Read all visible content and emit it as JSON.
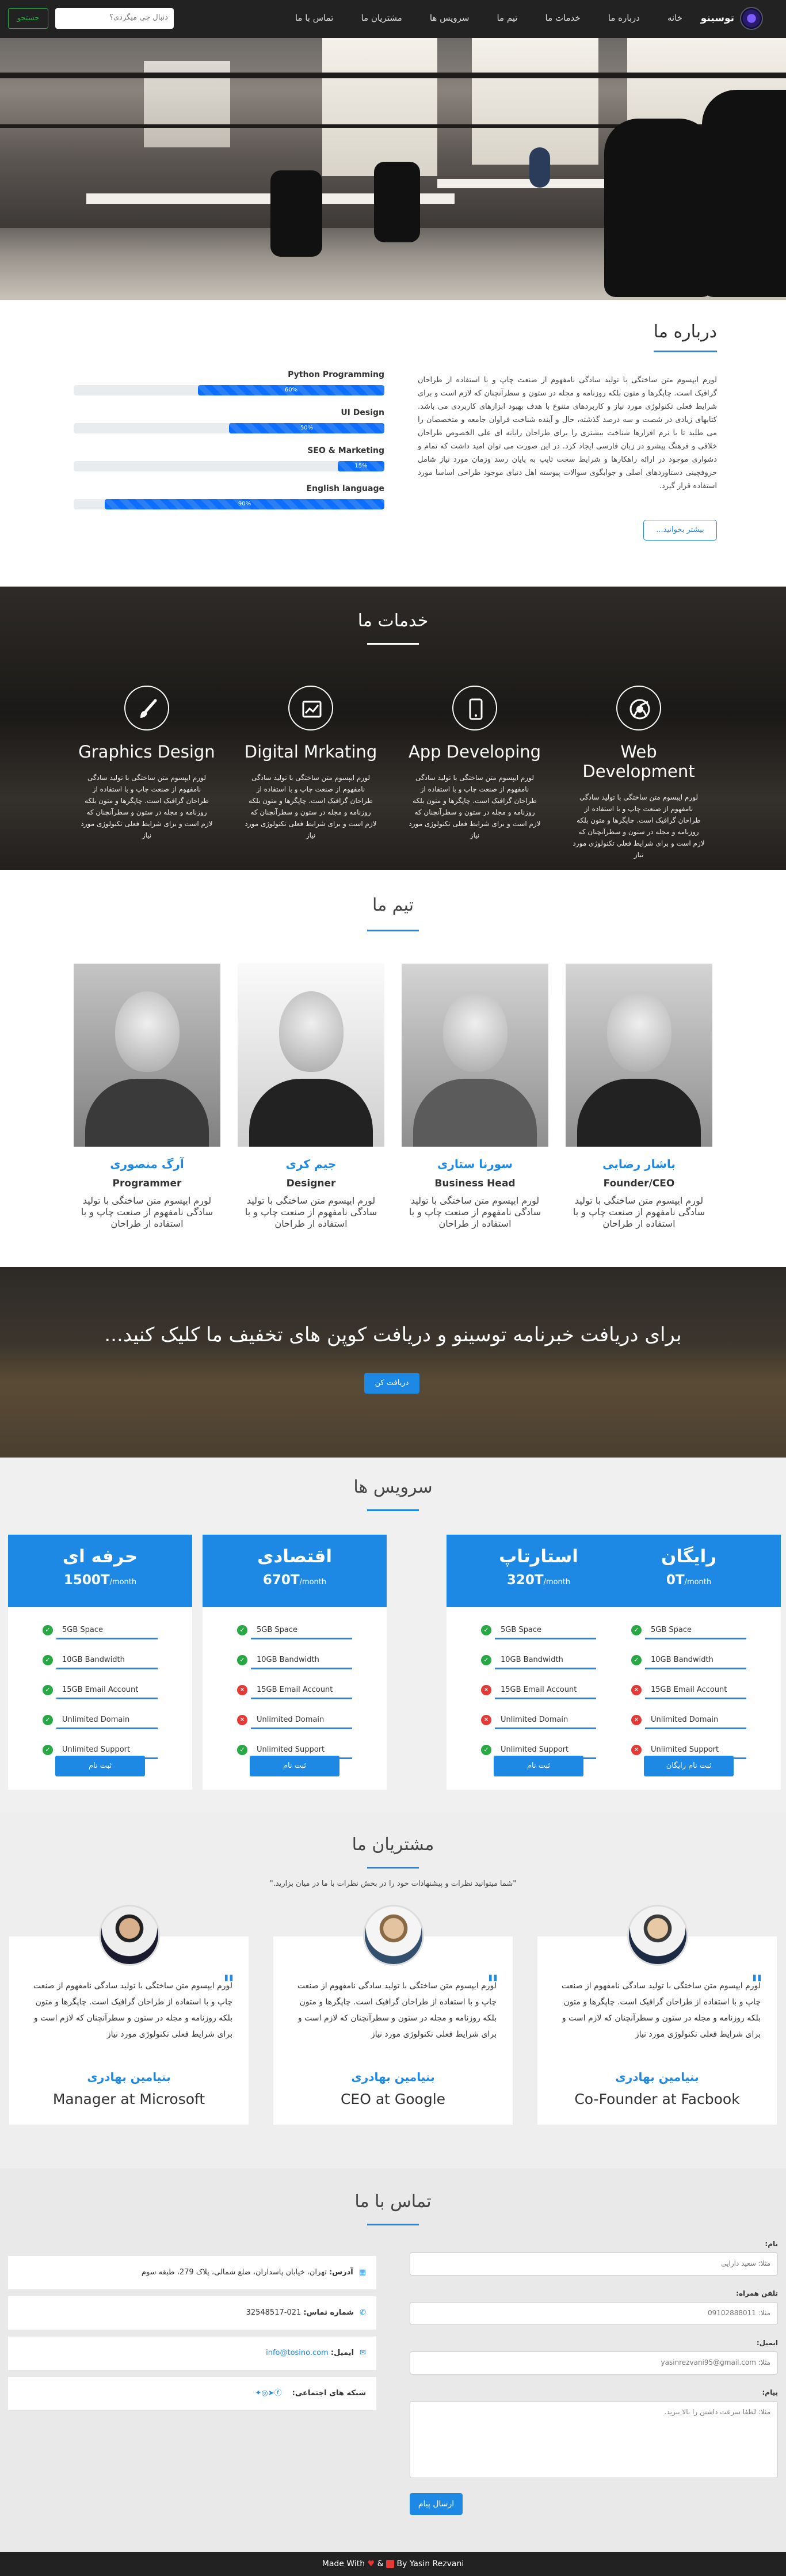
{
  "nav": {
    "brand": "توسینو",
    "items": [
      "خانه",
      "درباره ما",
      "خدمات ما",
      "تیم ما",
      "سرویس ها",
      "مشتریان ما",
      "تماس با ما"
    ],
    "search_placeholder": "دنبال چی میگردی؟",
    "search_button": "جستجو"
  },
  "about": {
    "title": "درباره ما",
    "text": "لورم ایپسوم متن ساختگی با تولید سادگی نامفهوم از صنعت چاپ و با استفاده از طراحان گرافیک است. چاپگرها و متون بلکه روزنامه و مجله در ستون و سطرآنچنان که لازم است و برای شرایط فعلی تکنولوژی مورد نیاز و کاربردهای متنوع با هدف بهبود ابزارهای کاربردی می باشد. کتابهای زیادی در شصت و سه درصد گذشته، حال و آینده شناخت فراوان جامعه و متخصصان را می طلبد تا با نرم افزارها شناخت بیشتری را برای طراحان رایانه ای علی الخصوص طراحان خلاقی و فرهنگ پیشرو در زبان فارسی ایجاد کرد. در این صورت می توان امید داشت که تمام و دشواری موجود در ارائه راهکارها و شرایط سخت تایپ به پایان رسد وزمان مورد نیاز شامل حروفچینی دستاوردهای اصلی و جوابگوی سوالات پیوسته اهل دنیای موجود طراحی اساسا مورد استفاده قرار گیرد.",
    "more_button": "بیشتر بخوانید...",
    "skills": [
      {
        "label": "Python Programming",
        "value": 60,
        "text": "60%"
      },
      {
        "label": "UI Design",
        "value": 50,
        "text": "50%"
      },
      {
        "label": "SEO & Marketing",
        "value": 15,
        "text": "15%"
      },
      {
        "label": "English language",
        "value": 90,
        "text": "90%"
      }
    ]
  },
  "services": {
    "title": "خدمات ما",
    "desc": "لورم ایپسوم متن ساختگی با تولید سادگی نامفهوم از صنعت چاپ و با استفاده از طراحان گرافیک است. چاپگرها و متون بلکه روزنامه و مجله در ستون و سطرآنچنان که لازم است و برای شرایط فعلی تکنولوژی مورد نیاز",
    "items": [
      {
        "title": "Web Development",
        "icon": "chrome-icon"
      },
      {
        "title": "App Developing",
        "icon": "mobile-icon"
      },
      {
        "title": "Digital Mrkating",
        "icon": "chart-icon"
      },
      {
        "title": "Graphics Design",
        "icon": "brush-icon"
      }
    ]
  },
  "team": {
    "title": "تیم ما",
    "desc": "لورم ایپسوم متن ساختگی با تولید سادگی نامفهوم از صنعت چاپ و با استفاده از طراحان",
    "members": [
      {
        "name": "باشار رضایی",
        "role": "Founder/CEO"
      },
      {
        "name": "سورنا ستاری",
        "role": "Business Head"
      },
      {
        "name": "جیم کری",
        "role": "Designer"
      },
      {
        "name": "آرگ منصوری",
        "role": "Programmer"
      }
    ]
  },
  "newsletter": {
    "text": "برای دریافت خبرنامه توسینو و دریافت کوپن های تخفیف ما کلیک کنید...",
    "button": "دریافت کن"
  },
  "pricing": {
    "title": "سرویس ها",
    "per": "/month",
    "plans": [
      {
        "name": "رایگان",
        "price": "0T",
        "button": "ثبت نام رایگان",
        "features": [
          {
            "t": "5GB Space",
            "ok": true
          },
          {
            "t": "10GB Bandwidth",
            "ok": true
          },
          {
            "t": "15GB Email Account",
            "ok": false
          },
          {
            "t": "Unlimited Domain",
            "ok": false
          },
          {
            "t": "Unlimited Support",
            "ok": false
          }
        ]
      },
      {
        "name": "استارتاپ",
        "price": "320T",
        "button": "ثبت نام",
        "features": [
          {
            "t": "5GB Space",
            "ok": true
          },
          {
            "t": "10GB Bandwidth",
            "ok": true
          },
          {
            "t": "15GB Email Account",
            "ok": false
          },
          {
            "t": "Unlimited Domain",
            "ok": false
          },
          {
            "t": "Unlimited Support",
            "ok": true
          }
        ]
      },
      {
        "name": "اقتصادی",
        "price": "670T",
        "button": "ثبت نام",
        "features": [
          {
            "t": "5GB Space",
            "ok": true
          },
          {
            "t": "10GB Bandwidth",
            "ok": true
          },
          {
            "t": "15GB Email Account",
            "ok": false
          },
          {
            "t": "Unlimited Domain",
            "ok": false
          },
          {
            "t": "Unlimited Support",
            "ok": true
          }
        ]
      },
      {
        "name": "حرفه ای",
        "price": "1500T",
        "button": "ثبت نام",
        "features": [
          {
            "t": "5GB Space",
            "ok": true
          },
          {
            "t": "10GB Bandwidth",
            "ok": true
          },
          {
            "t": "15GB Email Account",
            "ok": true
          },
          {
            "t": "Unlimited Domain",
            "ok": true
          },
          {
            "t": "Unlimited Support",
            "ok": true
          }
        ]
      }
    ]
  },
  "clients": {
    "title": "مشتریان ما",
    "subtitle": "\"شما میتوانید نظرات و پیشنهادات خود را در بخش نظرات با ما در میان بزارید.\"",
    "text": "لورم ایپسوم متن ساختگی با تولید سادگی نامفهوم از صنعت چاپ و با استفاده از طراحان گرافیک است. چاپگرها و متون بلکه روزنامه و مجله در ستون و سطرآنچنان که لازم است و برای شرایط فعلی تکنولوژی مورد نیاز",
    "items": [
      {
        "name": "بنیامین بهادری",
        "role": "Co-Founder at Facbook"
      },
      {
        "name": "بنیامین بهادری",
        "role": "CEO at Google"
      },
      {
        "name": "بنیامین بهادری",
        "role": "Manager at Microsoft"
      }
    ]
  },
  "contact": {
    "title": "تماس با ما",
    "labels": {
      "name": "نام:",
      "phone": "تلفن همراه:",
      "email": "ایمیل:",
      "message": "پیام:"
    },
    "placeholders": {
      "name": "مثلا: سعید دارایی",
      "phone": "مثلا: 09102888011",
      "email": "مثلا: yasinrezvani95@gmail.com",
      "message": "مثلا: لطفا سرعت داشتن را بالا ببرید."
    },
    "send": "ارسال پیام",
    "address_label": "آدرس:",
    "address": "تهران، خیابان پاسداران، ضلع شمالی، پلاک 279، طبقه سوم",
    "phone_label": "شماره تماس:",
    "phone": "021-32548517",
    "email_label": "ایمیل:",
    "email": "info@tosino.com",
    "social_label": "شبکه های اجتماعی:"
  },
  "footer": {
    "made": "Made With",
    "and": "&",
    "by": "By Yasin Rezvani"
  }
}
